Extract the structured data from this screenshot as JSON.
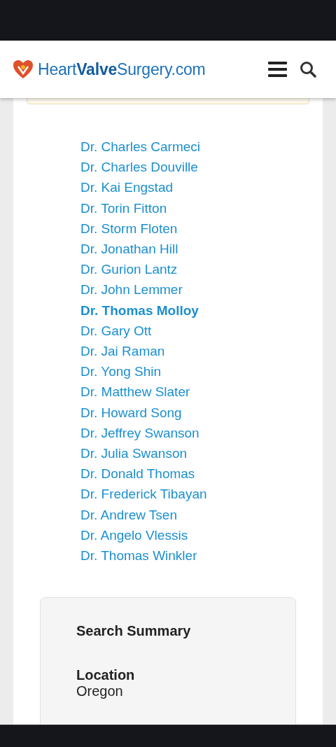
{
  "header": {
    "logo": "Heart**Valve**Surgery.com"
  },
  "doctors": [
    {
      "name": "Dr. Charles Carmeci",
      "selected": false
    },
    {
      "name": "Dr. Charles Douville",
      "selected": false
    },
    {
      "name": "Dr. Kai Engstad",
      "selected": false
    },
    {
      "name": "Dr. Torin Fitton",
      "selected": false
    },
    {
      "name": "Dr. Storm Floten",
      "selected": false
    },
    {
      "name": "Dr. Jonathan Hill",
      "selected": false
    },
    {
      "name": "Dr. Gurion Lantz",
      "selected": false
    },
    {
      "name": "Dr. John Lemmer",
      "selected": false
    },
    {
      "name": "Dr. Thomas Molloy",
      "selected": true
    },
    {
      "name": "Dr. Gary Ott",
      "selected": false
    },
    {
      "name": "Dr. Jai Raman",
      "selected": false
    },
    {
      "name": "Dr. Yong Shin",
      "selected": false
    },
    {
      "name": "Dr. Matthew Slater",
      "selected": false
    },
    {
      "name": "Dr. Howard Song",
      "selected": false
    },
    {
      "name": "Dr. Jeffrey Swanson",
      "selected": false
    },
    {
      "name": "Dr. Julia Swanson",
      "selected": false
    },
    {
      "name": "Dr. Donald Thomas",
      "selected": false
    },
    {
      "name": "Dr. Frederick Tibayan",
      "selected": false
    },
    {
      "name": "Dr. Andrew Tsen",
      "selected": false
    },
    {
      "name": "Dr. Angelo Vlessis",
      "selected": false
    },
    {
      "name": "Dr. Thomas Winkler",
      "selected": false
    }
  ],
  "search_summary": {
    "title": "Search Summary",
    "fields": [
      {
        "label": "Location",
        "value": "Oregon"
      }
    ]
  }
}
